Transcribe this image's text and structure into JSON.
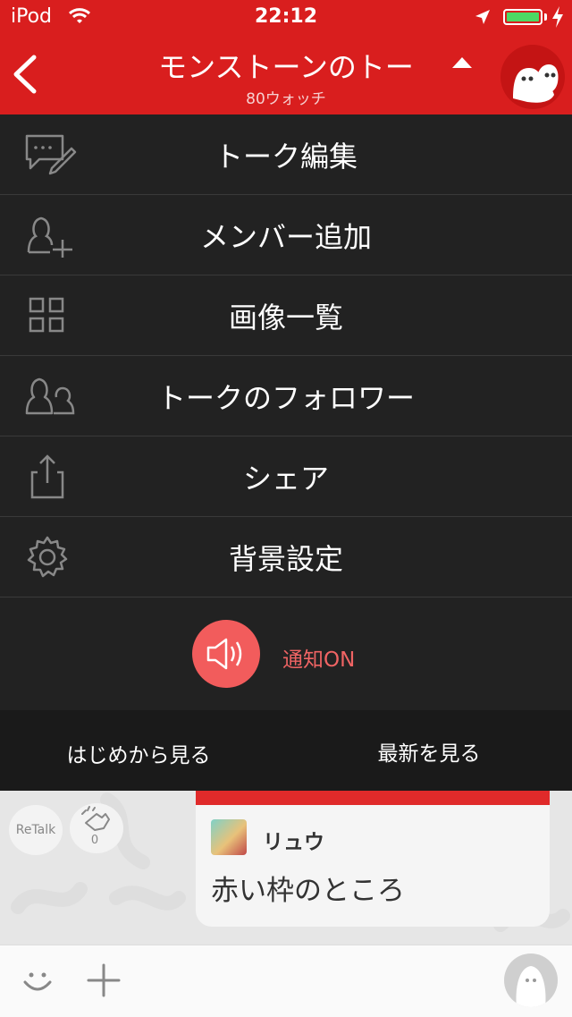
{
  "status_bar": {
    "carrier": "iPod",
    "time": "22:12"
  },
  "header": {
    "back_icon": "chevron-left-icon",
    "title": "モンストーンのトー",
    "subtitle": "80ウォッチ",
    "colors": {
      "header_bg": "#d91e1e",
      "accent": "#f25c5c"
    }
  },
  "menu": {
    "items": [
      {
        "label": "トーク編集",
        "icon": "chat-edit-icon"
      },
      {
        "label": "メンバー追加",
        "icon": "add-member-icon"
      },
      {
        "label": "画像一覧",
        "icon": "grid-icon"
      },
      {
        "label": "トークのフォロワー",
        "icon": "followers-icon"
      },
      {
        "label": "シェア",
        "icon": "share-icon"
      },
      {
        "label": "背景設定",
        "icon": "gear-icon"
      }
    ],
    "notification": {
      "label": "通知ON",
      "icon": "speaker-icon"
    }
  },
  "jump": {
    "from_start": "はじめから見る",
    "latest": "最新を見る"
  },
  "chat": {
    "retalk_label": "ReTalk",
    "clap_count": "0",
    "message": {
      "author": "リュウ",
      "text": "赤い枠のところ"
    }
  }
}
